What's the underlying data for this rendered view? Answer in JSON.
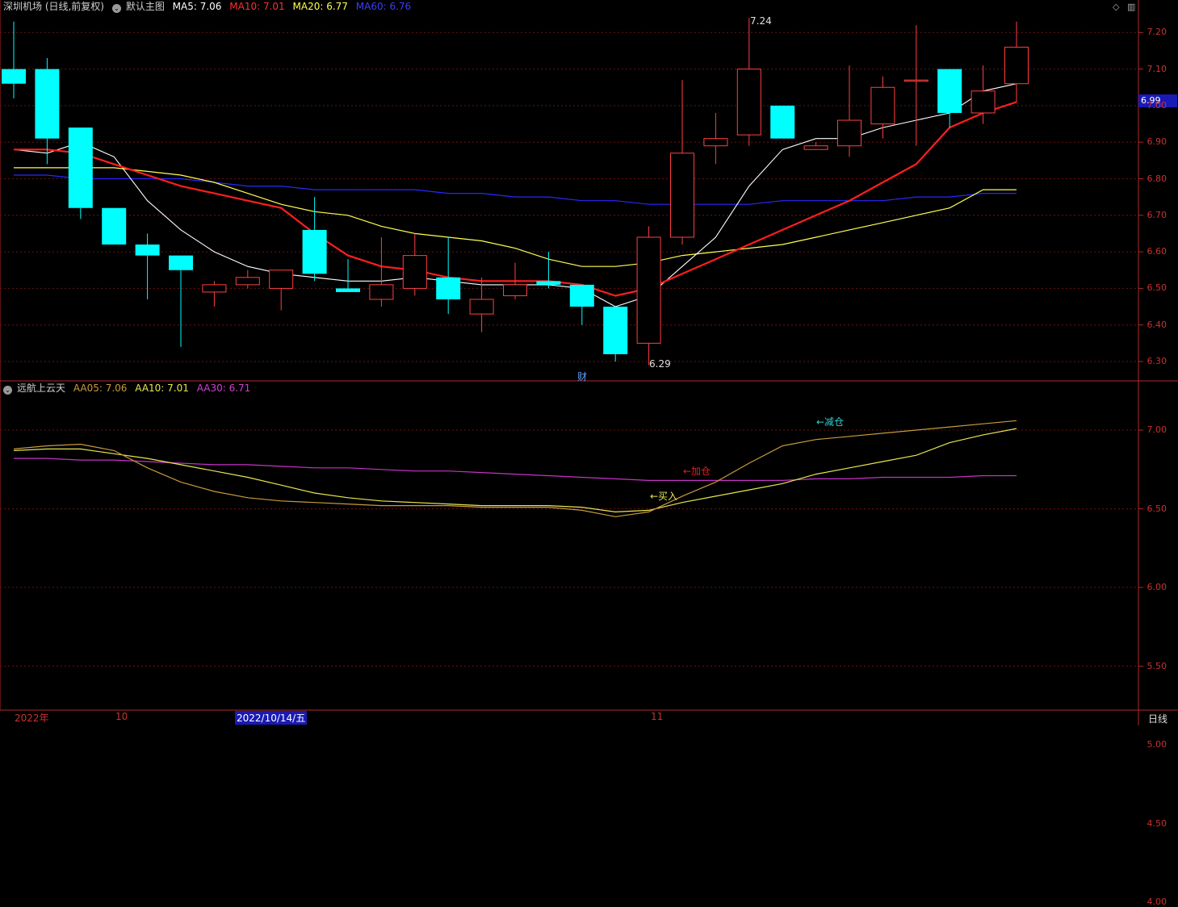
{
  "header": {
    "title": "深圳机场 (日线,前复权)",
    "template": "默认主图",
    "ma5": "MA5: 7.06",
    "ma10": "MA10: 7.01",
    "ma20": "MA20: 6.77",
    "ma60": "MA60: 6.76"
  },
  "sub_header": {
    "indicator": "远航上云天",
    "aa05": "AA05: 7.06",
    "aa10": "AA10: 7.01",
    "aa30": "AA30: 6.71"
  },
  "current_price_tag": "6.99",
  "period_label": "日线",
  "x_labels": [
    "2022年",
    "10",
    "2022/10/14/五",
    "11"
  ],
  "annotations": {
    "high": "7.24",
    "low": "6.29",
    "fin": "财",
    "sell": "←减仓",
    "add": "←加仓",
    "buy": "←买入"
  },
  "colors": {
    "up": "#ff4040",
    "down": "#00ffff",
    "ma5": "#ffffff",
    "ma10": "#ff1e1e",
    "ma20": "#ffff50",
    "ma60": "#2828ff",
    "aa05": "#c89a3c",
    "aa10": "#e6e650",
    "aa30": "#c832c8",
    "axis": "#b42828",
    "tag_bg": "#1a1ab4"
  },
  "chart_data": [
    {
      "type": "candlestick",
      "title": "深圳机场 (日线,前复权)",
      "ylim": [
        6.24,
        7.24
      ],
      "yticks": [
        6.3,
        6.4,
        6.5,
        6.6,
        6.7,
        6.8,
        6.9,
        7.0,
        7.1,
        7.2
      ],
      "candles": [
        {
          "o": 7.1,
          "h": 7.23,
          "l": 7.02,
          "c": 7.06
        },
        {
          "o": 7.1,
          "h": 7.13,
          "l": 6.84,
          "c": 6.91
        },
        {
          "o": 6.94,
          "h": 6.94,
          "l": 6.69,
          "c": 6.72
        },
        {
          "o": 6.72,
          "h": 6.72,
          "l": 6.62,
          "c": 6.62
        },
        {
          "o": 6.62,
          "h": 6.65,
          "l": 6.47,
          "c": 6.59
        },
        {
          "o": 6.59,
          "h": 6.59,
          "l": 6.34,
          "c": 6.55
        },
        {
          "o": 6.49,
          "h": 6.52,
          "l": 6.45,
          "c": 6.51
        },
        {
          "o": 6.51,
          "h": 6.55,
          "l": 6.5,
          "c": 6.53
        },
        {
          "o": 6.5,
          "h": 6.55,
          "l": 6.44,
          "c": 6.55
        },
        {
          "o": 6.66,
          "h": 6.75,
          "l": 6.52,
          "c": 6.54
        },
        {
          "o": 6.5,
          "h": 6.58,
          "l": 6.49,
          "c": 6.49
        },
        {
          "o": 6.47,
          "h": 6.64,
          "l": 6.45,
          "c": 6.51
        },
        {
          "o": 6.5,
          "h": 6.65,
          "l": 6.48,
          "c": 6.59
        },
        {
          "o": 6.53,
          "h": 6.64,
          "l": 6.43,
          "c": 6.47
        },
        {
          "o": 6.43,
          "h": 6.53,
          "l": 6.38,
          "c": 6.47
        },
        {
          "o": 6.48,
          "h": 6.57,
          "l": 6.47,
          "c": 6.51
        },
        {
          "o": 6.52,
          "h": 6.6,
          "l": 6.5,
          "c": 6.51
        },
        {
          "o": 6.51,
          "h": 6.51,
          "l": 6.4,
          "c": 6.45
        },
        {
          "o": 6.45,
          "h": 6.45,
          "l": 6.3,
          "c": 6.32
        },
        {
          "o": 6.35,
          "h": 6.67,
          "l": 6.29,
          "c": 6.64
        },
        {
          "o": 6.64,
          "h": 7.07,
          "l": 6.62,
          "c": 6.87
        },
        {
          "o": 6.89,
          "h": 6.98,
          "l": 6.84,
          "c": 6.91
        },
        {
          "o": 6.92,
          "h": 7.24,
          "l": 6.89,
          "c": 7.1
        },
        {
          "o": 7.0,
          "h": 7.0,
          "l": 6.91,
          "c": 6.91
        },
        {
          "o": 6.88,
          "h": 6.9,
          "l": 6.88,
          "c": 6.89
        },
        {
          "o": 6.89,
          "h": 7.11,
          "l": 6.86,
          "c": 6.96
        },
        {
          "o": 6.95,
          "h": 7.08,
          "l": 6.91,
          "c": 7.05
        },
        {
          "o": 7.07,
          "h": 7.22,
          "l": 6.89,
          "c": 7.07
        },
        {
          "o": 7.1,
          "h": 7.1,
          "l": 6.94,
          "c": 6.98
        },
        {
          "o": 6.98,
          "h": 7.11,
          "l": 6.95,
          "c": 7.04
        },
        {
          "o": 7.06,
          "h": 7.23,
          "l": 7.01,
          "c": 7.16
        }
      ],
      "series": [
        {
          "name": "MA5",
          "values": [
            6.88,
            6.87,
            6.9,
            6.86,
            6.74,
            6.66,
            6.6,
            6.56,
            6.54,
            6.53,
            6.52,
            6.52,
            6.53,
            6.52,
            6.51,
            6.51,
            6.51,
            6.5,
            6.45,
            6.48,
            6.56,
            6.64,
            6.78,
            6.88,
            6.91,
            6.91,
            6.94,
            6.96,
            6.98,
            7.04,
            7.06
          ]
        },
        {
          "name": "MA10",
          "values": [
            6.88,
            6.88,
            6.87,
            6.84,
            6.81,
            6.78,
            6.76,
            6.74,
            6.72,
            6.65,
            6.59,
            6.56,
            6.55,
            6.53,
            6.52,
            6.52,
            6.52,
            6.51,
            6.48,
            6.5,
            6.54,
            6.58,
            6.62,
            6.66,
            6.7,
            6.74,
            6.79,
            6.84,
            6.94,
            6.98,
            7.01
          ]
        },
        {
          "name": "MA20",
          "values": [
            6.83,
            6.83,
            6.83,
            6.83,
            6.82,
            6.81,
            6.79,
            6.76,
            6.73,
            6.71,
            6.7,
            6.67,
            6.65,
            6.64,
            6.63,
            6.61,
            6.58,
            6.56,
            6.56,
            6.57,
            6.59,
            6.6,
            6.61,
            6.62,
            6.64,
            6.66,
            6.68,
            6.7,
            6.72,
            6.77,
            6.77
          ]
        },
        {
          "name": "MA60",
          "values": [
            6.81,
            6.81,
            6.8,
            6.8,
            6.8,
            6.8,
            6.79,
            6.78,
            6.78,
            6.77,
            6.77,
            6.77,
            6.77,
            6.76,
            6.76,
            6.75,
            6.75,
            6.74,
            6.74,
            6.73,
            6.73,
            6.73,
            6.73,
            6.74,
            6.74,
            6.74,
            6.74,
            6.75,
            6.75,
            6.76,
            6.76
          ]
        }
      ]
    },
    {
      "type": "line",
      "title": "远航上云天",
      "ylim": [
        3.5,
        7.5
      ],
      "yticks": [
        4.0,
        4.5,
        5.0,
        5.5,
        6.0,
        6.5,
        7.0
      ],
      "series": [
        {
          "name": "AA05",
          "values": [
            6.88,
            6.9,
            6.91,
            6.87,
            6.76,
            6.67,
            6.61,
            6.57,
            6.55,
            6.54,
            6.53,
            6.52,
            6.52,
            6.52,
            6.51,
            6.51,
            6.51,
            6.49,
            6.45,
            6.48,
            6.58,
            6.67,
            6.79,
            6.9,
            6.94,
            6.96,
            6.98,
            7.0,
            7.02,
            7.04,
            7.06
          ]
        },
        {
          "name": "AA10",
          "values": [
            6.87,
            6.88,
            6.88,
            6.85,
            6.82,
            6.78,
            6.74,
            6.7,
            6.65,
            6.6,
            6.57,
            6.55,
            6.54,
            6.53,
            6.52,
            6.52,
            6.52,
            6.51,
            6.48,
            6.49,
            6.54,
            6.58,
            6.62,
            6.66,
            6.72,
            6.76,
            6.8,
            6.84,
            6.92,
            6.97,
            7.01
          ]
        },
        {
          "name": "AA30",
          "values": [
            6.82,
            6.82,
            6.81,
            6.81,
            6.8,
            6.79,
            6.78,
            6.78,
            6.77,
            6.76,
            6.76,
            6.75,
            6.74,
            6.74,
            6.73,
            6.72,
            6.71,
            6.7,
            6.69,
            6.68,
            6.68,
            6.68,
            6.68,
            6.68,
            6.69,
            6.69,
            6.7,
            6.7,
            6.7,
            6.71,
            6.71
          ]
        }
      ]
    }
  ]
}
